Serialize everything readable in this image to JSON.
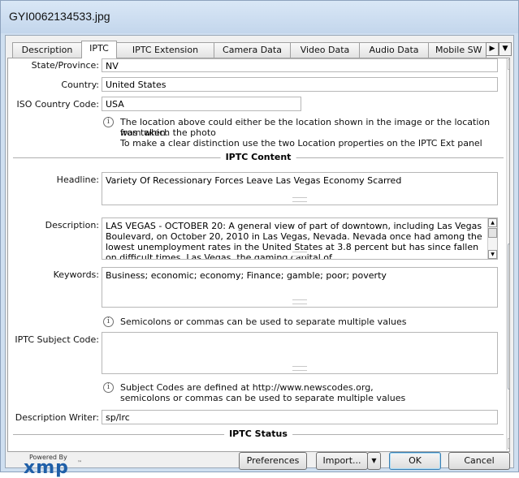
{
  "window": {
    "title": "GYI0062134533.jpg"
  },
  "tabs": [
    {
      "label": "Description",
      "active": false
    },
    {
      "label": "IPTC",
      "active": true
    },
    {
      "label": "IPTC Extension",
      "active": false
    },
    {
      "label": "Camera Data",
      "active": false
    },
    {
      "label": "Video Data",
      "active": false
    },
    {
      "label": "Audio Data",
      "active": false
    },
    {
      "label": "Mobile SW",
      "active": false
    }
  ],
  "fields": {
    "state": {
      "label": "State/Province:",
      "value": "NV"
    },
    "country": {
      "label": "Country:",
      "value": "United States"
    },
    "iso_country": {
      "label": "ISO Country Code:",
      "value": "USA"
    },
    "headline": {
      "label": "Headline:",
      "value": "Variety Of Recessionary Forces Leave Las Vegas Economy Scarred"
    },
    "description": {
      "label": "Description:",
      "value": "LAS VEGAS - OCTOBER 20:  A general view of part of downtown, including Las Vegas Boulevard, on October 20, 2010 in Las Vegas, Nevada. Nevada once had among the lowest unemployment rates in the United States at 3.8 percent but has since fallen on difficult times. Las Vegas, the gaming capital of"
    },
    "keywords": {
      "label": "Keywords:",
      "value": "Business; economic; economy; Finance; gamble; poor; poverty"
    },
    "subject_code": {
      "label": "IPTC Subject Code:",
      "value": ""
    },
    "description_writer": {
      "label": "Description Writer:",
      "value": "sp/lrc"
    }
  },
  "notes": {
    "location_line1": "The location above could either be the location shown in the image or the location from which the photo",
    "location_line2": "was taken.",
    "location_line3": "To make a clear distinction use the two Location properties on the IPTC Ext panel",
    "keywords": "Semicolons or commas can be used to separate multiple values",
    "subject_line1": "Subject Codes are defined at http://www.newscodes.org,",
    "subject_line2": "semicolons or commas can be used to separate multiple values"
  },
  "sections": {
    "iptc_content": "IPTC Content",
    "iptc_status": "IPTC Status"
  },
  "footer": {
    "powered_by": "Powered By",
    "logo": "xmp",
    "preferences": "Preferences",
    "import": "Import...",
    "ok": "OK",
    "cancel": "Cancel"
  },
  "icons": {
    "info": "info-icon",
    "tab_scroll_right": "arrow-right-icon",
    "tab_dropdown": "chevron-down-icon",
    "scroll_up": "arrow-up-icon",
    "scroll_down": "arrow-down-icon",
    "import_dropdown": "chevron-down-icon"
  }
}
